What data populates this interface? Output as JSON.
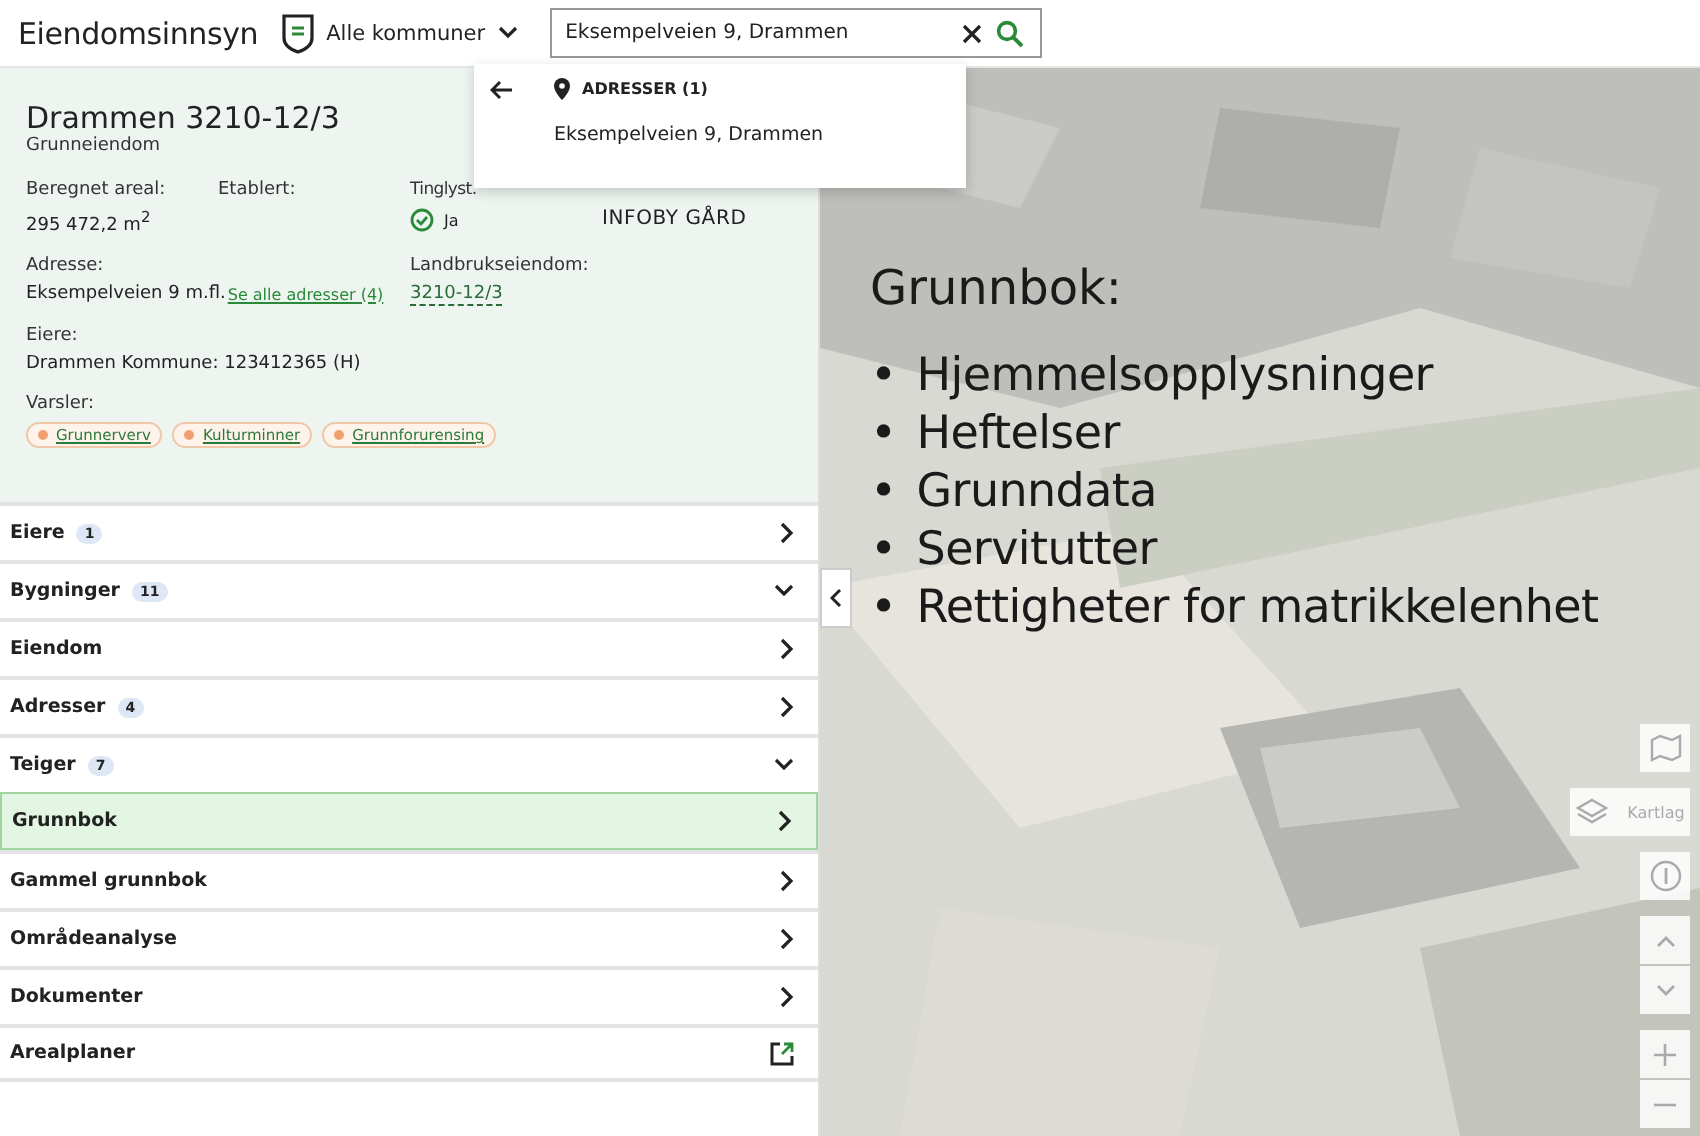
{
  "header": {
    "app_title": "Eiendomsinnsyn",
    "municipality_selector": "Alle kommuner",
    "search": {
      "value": "Eksempelveien 9, Drammen"
    }
  },
  "search_dropdown": {
    "group_label": "ADRESSER (1)",
    "results": [
      "Eksempelveien 9, Drammen"
    ]
  },
  "property": {
    "title": "Drammen 3210-12/3",
    "subtitle": "Grunneiendom",
    "fields": [
      {
        "label": "Beregnet areal:",
        "value": "295 472,2 m$^{2}$"
      },
      {
        "label": "Etablert:"
      },
      {
        "label": "Tinglyst.",
        "value": "Ja",
        "checked": true
      },
      {
        "value": "INFOBY GÅRD"
      }
    ],
    "address": {
      "label": "Adresse:",
      "value": "Eksempelveien 9  m.fl.",
      "link": "Se alle adresser (4)"
    },
    "farm": {
      "label": "Landbrukseiendom:",
      "link": "3210-12/3"
    },
    "owners": {
      "label": "Eiere:",
      "value": "Drammen Kommune: 123412365 (H)"
    },
    "warnings": {
      "label": "Varsler:",
      "tags": [
        {
          "label": "Grunnerverv",
          "color": "#f0a070"
        },
        {
          "label": "Kulturminner",
          "color": "#f0a070"
        },
        {
          "label": "Grunnforurensing",
          "color": "#f0a070"
        }
      ]
    }
  },
  "sections": [
    {
      "label": "Eiere",
      "count": "1",
      "kind": "chevron",
      "expanded": false,
      "selected": false
    },
    {
      "label": "Bygninger",
      "count": "11",
      "kind": "chevron",
      "expanded": true,
      "selected": false
    },
    {
      "label": "Eiendom",
      "kind": "chevron",
      "expanded": false,
      "selected": false
    },
    {
      "label": "Adresser",
      "count": "4",
      "kind": "chevron",
      "expanded": false,
      "selected": false
    },
    {
      "label": "Teiger",
      "count": "7",
      "kind": "chevron",
      "expanded": true,
      "selected": false
    },
    {
      "label": "Grunnbok",
      "kind": "chevron",
      "expanded": false,
      "selected": true
    },
    {
      "label": "Gammel grunnbok",
      "kind": "chevron",
      "expanded": false,
      "selected": false
    },
    {
      "label": "Områdeanalyse",
      "kind": "chevron",
      "expanded": false,
      "selected": false
    },
    {
      "label": "Dokumenter",
      "kind": "chevron",
      "expanded": false,
      "selected": false
    },
    {
      "label": "Arealplaner",
      "kind": "external",
      "selected": false
    }
  ],
  "map": {
    "kind": "picture",
    "overlay": {
      "heading": "Grunnbok:",
      "bullets": [
        {
          "marker": "•",
          "text": "Hjemmelsopplysninger"
        },
        {
          "marker": "•",
          "text": "Heftelser"
        },
        {
          "marker": "•",
          "text": "Grunndata"
        },
        {
          "marker": "•",
          "text": "Servitutter"
        },
        {
          "marker": "•",
          "text": "Rettigheter for matrikkelenhet"
        }
      ]
    },
    "layers_button": "Kartlag"
  }
}
